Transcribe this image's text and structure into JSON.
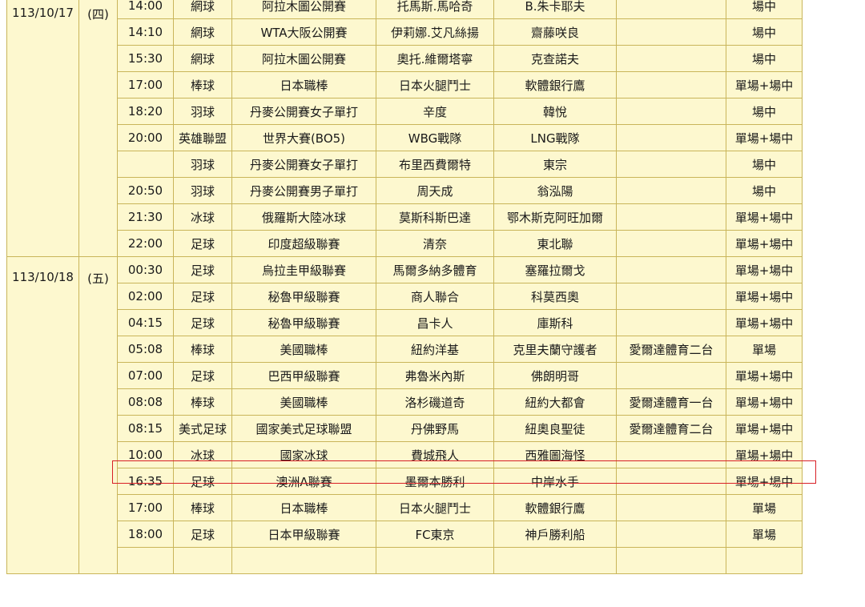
{
  "days": [
    {
      "date": "113/10/17",
      "dow": "(四)",
      "rows": [
        {
          "time": "14:00",
          "sport": "網球",
          "league": "阿拉木圖公開賽",
          "home": "托馬斯.馬哈奇",
          "away": "B.朱卡耶夫",
          "channel": "",
          "bet": "場中"
        },
        {
          "time": "14:10",
          "sport": "網球",
          "league": "WTA大阪公開賽",
          "home": "伊莉娜.艾凡絲揚",
          "away": "齋藤咲良",
          "channel": "",
          "bet": "場中"
        },
        {
          "time": "15:30",
          "sport": "網球",
          "league": "阿拉木圖公開賽",
          "home": "奧托.維爾塔寧",
          "away": "克查諾夫",
          "channel": "",
          "bet": "場中"
        },
        {
          "time": "17:00",
          "sport": "棒球",
          "league": "日本職棒",
          "home": "日本火腿鬥士",
          "away": "軟體銀行鷹",
          "channel": "",
          "bet": "單場+場中"
        },
        {
          "time": "18:20",
          "sport": "羽球",
          "league": "丹麥公開賽女子單打",
          "home": "辛度",
          "away": "韓悅",
          "channel": "",
          "bet": "場中"
        },
        {
          "time": "20:00",
          "sport": "英雄聯盟",
          "league": "世界大賽(BO5)",
          "home": "WBG戰隊",
          "away": "LNG戰隊",
          "channel": "",
          "bet": "單場+場中"
        },
        {
          "time": "",
          "sport": "羽球",
          "league": "丹麥公開賽女子單打",
          "home": "布里西費爾特",
          "away": "東宗",
          "channel": "",
          "bet": "場中"
        },
        {
          "time": "20:50",
          "sport": "羽球",
          "league": "丹麥公開賽男子單打",
          "home": "周天成",
          "away": "翁泓陽",
          "channel": "",
          "bet": "場中"
        },
        {
          "time": "21:30",
          "sport": "冰球",
          "league": "俄羅斯大陸冰球",
          "home": "莫斯科斯巴達",
          "away": "鄂木斯克阿旺加爾",
          "channel": "",
          "bet": "單場+場中"
        },
        {
          "time": "22:00",
          "sport": "足球",
          "league": "印度超級聯賽",
          "home": "清奈",
          "away": "東北聯",
          "channel": "",
          "bet": "單場+場中"
        }
      ]
    },
    {
      "date": "113/10/18",
      "dow": "(五)",
      "rows": [
        {
          "time": "00:30",
          "sport": "足球",
          "league": "烏拉圭甲級聯賽",
          "home": "馬爾多納多體育",
          "away": "塞羅拉爾戈",
          "channel": "",
          "bet": "單場+場中"
        },
        {
          "time": "02:00",
          "sport": "足球",
          "league": "秘魯甲級聯賽",
          "home": "商人聯合",
          "away": "科莫西奧",
          "channel": "",
          "bet": "單場+場中"
        },
        {
          "time": "04:15",
          "sport": "足球",
          "league": "秘魯甲級聯賽",
          "home": "昌卡人",
          "away": "庫斯科",
          "channel": "",
          "bet": "單場+場中"
        },
        {
          "time": "05:08",
          "sport": "棒球",
          "league": "美國職棒",
          "home": "紐約洋基",
          "away": "克里夫蘭守護者",
          "channel": "愛爾達體育二台",
          "bet": "單場"
        },
        {
          "time": "07:00",
          "sport": "足球",
          "league": "巴西甲級聯賽",
          "home": "弗魯米內斯",
          "away": "佛朗明哥",
          "channel": "",
          "bet": "單場+場中"
        },
        {
          "time": "08:08",
          "sport": "棒球",
          "league": "美國職棒",
          "home": "洛杉磯道奇",
          "away": "紐約大都會",
          "channel": "愛爾達體育一台",
          "bet": "單場+場中"
        },
        {
          "time": "08:15",
          "sport": "美式足球",
          "league": "國家美式足球聯盟",
          "home": "丹佛野馬",
          "away": "紐奧良聖徒",
          "channel": "愛爾達體育二台",
          "bet": "單場+場中"
        },
        {
          "time": "10:00",
          "sport": "冰球",
          "league": "國家冰球",
          "home": "費城飛人",
          "away": "西雅圖海怪",
          "channel": "",
          "bet": "單場+場中"
        },
        {
          "time": "16:35",
          "sport": "足球",
          "league": "澳洲A聯賽",
          "home": "墨爾本勝利",
          "away": "中岸水手",
          "channel": "",
          "bet": "單場+場中"
        },
        {
          "time": "17:00",
          "sport": "棒球",
          "league": "日本職棒",
          "home": "日本火腿鬥士",
          "away": "軟體銀行鷹",
          "channel": "",
          "bet": "單場"
        },
        {
          "time": "18:00",
          "sport": "足球",
          "league": "日本甲級聯賽",
          "home": "FC東京",
          "away": "神戶勝利船",
          "channel": "",
          "bet": "單場"
        },
        {
          "time": "",
          "sport": "",
          "league": "",
          "home": "",
          "away": "",
          "channel": "",
          "bet": ""
        }
      ]
    }
  ],
  "colors": {
    "row_bg": "#fdf8cf",
    "border": "#c9b55a",
    "highlight": "#d81f26"
  }
}
